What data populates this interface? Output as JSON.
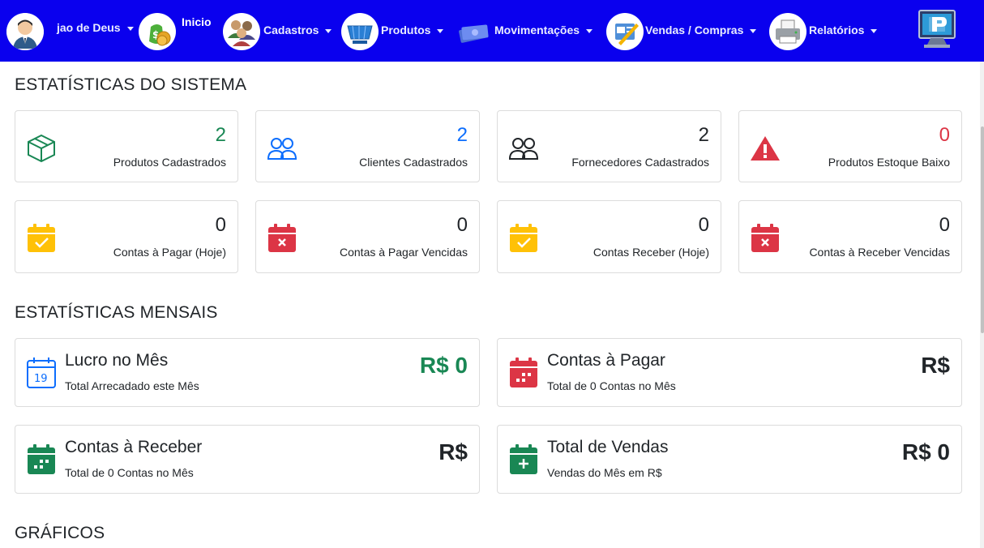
{
  "nav": {
    "user_label": "jao de Deus",
    "inicio_label": "Inicio",
    "cadastros_label": "Cadastros",
    "produtos_label": "Produtos",
    "movimentacoes_label": "Movimentações",
    "vendas_compras_label": "Vendas / Compras",
    "relatorios_label": "Relatórios",
    "background_color": "#0a00ee"
  },
  "sections": {
    "system": "ESTATÍSTICAS DO SISTEMA",
    "monthly": "ESTATÍSTICAS MENSAIS",
    "charts": "GRÁFICOS"
  },
  "stats": [
    {
      "value": "2",
      "label": "Produtos Cadastrados",
      "icon": "box-icon",
      "color": "#198754"
    },
    {
      "value": "2",
      "label": "Clientes Cadastrados",
      "icon": "people-icon",
      "color": "#0d6efd"
    },
    {
      "value": "2",
      "label": "Fornecedores Cadastrados",
      "icon": "people-icon",
      "color": "#212529"
    },
    {
      "value": "0",
      "label": "Produtos Estoque Baixo",
      "icon": "warning-icon",
      "color": "#dc3545"
    },
    {
      "value": "0",
      "label": "Contas à Pagar (Hoje)",
      "icon": "calendar-check-icon",
      "color": "#212529"
    },
    {
      "value": "0",
      "label": "Contas à Pagar Vencidas",
      "icon": "calendar-x-icon",
      "color": "#212529"
    },
    {
      "value": "0",
      "label": "Contas Receber (Hoje)",
      "icon": "calendar-check-icon",
      "color": "#212529"
    },
    {
      "value": "0",
      "label": "Contas à Receber Vencidas",
      "icon": "calendar-x-icon",
      "color": "#212529"
    }
  ],
  "monthly": [
    {
      "title": "Lucro no Mês",
      "subtitle": "Total Arrecadado este Mês",
      "value": "R$ 0",
      "icon": "calendar-19-icon",
      "color": "#198754"
    },
    {
      "title": "Contas à Pagar",
      "subtitle": "Total de 0 Contas no Mês",
      "value": "R$",
      "icon": "calendar-red-icon",
      "color": "#212529"
    },
    {
      "title": "Contas à Receber",
      "subtitle": "Total de 0 Contas no Mês",
      "value": "R$",
      "icon": "calendar-green-icon",
      "color": "#212529"
    },
    {
      "title": "Total de Vendas",
      "subtitle": "Vendas do Mês em R$",
      "value": "R$ 0",
      "icon": "calendar-plus-icon",
      "color": "#212529"
    }
  ],
  "colors": {
    "success": "#198754",
    "primary": "#0d6efd",
    "danger": "#dc3545",
    "warning": "#ffc107"
  }
}
